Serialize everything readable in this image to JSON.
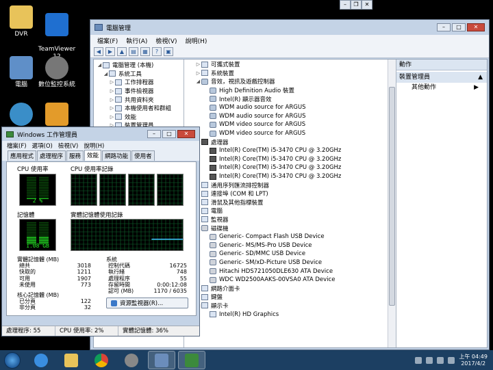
{
  "desktop": {
    "icons": [
      {
        "label": "DVR"
      },
      {
        "label": "TeamViewer\n12"
      },
      {
        "label": "電腦"
      },
      {
        "label": "數位監控系統"
      }
    ]
  },
  "device_manager": {
    "title": "電腦管理",
    "menu": [
      "檔案(F)",
      "執行(A)",
      "檢視(V)",
      "說明(H)"
    ],
    "left_tree": [
      {
        "label": "電腦管理 (本機)",
        "indent": 0
      },
      {
        "label": "系統工具",
        "indent": 1
      },
      {
        "label": "工作排程器",
        "indent": 2
      },
      {
        "label": "事件檢視器",
        "indent": 2
      },
      {
        "label": "共用資料夾",
        "indent": 2
      },
      {
        "label": "本機使用者和群組",
        "indent": 2
      },
      {
        "label": "效能",
        "indent": 2
      },
      {
        "label": "裝置管理員",
        "indent": 2
      }
    ],
    "device_tree": [
      {
        "label": "可攜式裝置",
        "level": 0,
        "icon": "device"
      },
      {
        "label": "系統裝置",
        "level": 0,
        "icon": "device"
      },
      {
        "label": "音效，視訊及遊戲控制器",
        "level": 0,
        "icon": "snd",
        "expanded": true
      },
      {
        "label": "High Definition Audio 裝置",
        "level": 1,
        "icon": "snd"
      },
      {
        "label": "Intel(R) 顯示器音效",
        "level": 1,
        "icon": "snd"
      },
      {
        "label": "WDM audio source for ARGUS",
        "level": 1,
        "icon": "snd"
      },
      {
        "label": "WDM audio source for ARGUS",
        "level": 1,
        "icon": "snd"
      },
      {
        "label": "WDM video source for ARGUS",
        "level": 1,
        "icon": "snd"
      },
      {
        "label": "WDM video source for ARGUS",
        "level": 1,
        "icon": "snd"
      },
      {
        "label": "處理器",
        "level": 0,
        "icon": "chip",
        "expanded": true
      },
      {
        "label": "Intel(R) Core(TM) i5-3470 CPU @ 3.20GHz",
        "level": 1,
        "icon": "chip"
      },
      {
        "label": "Intel(R) Core(TM) i5-3470 CPU @ 3.20GHz",
        "level": 1,
        "icon": "chip"
      },
      {
        "label": "Intel(R) Core(TM) i5-3470 CPU @ 3.20GHz",
        "level": 1,
        "icon": "chip"
      },
      {
        "label": "Intel(R) Core(TM) i5-3470 CPU @ 3.20GHz",
        "level": 1,
        "icon": "chip"
      },
      {
        "label": "通用序列匯流排控制器",
        "level": 0,
        "icon": "device"
      },
      {
        "label": "連接埠 (COM 和 LPT)",
        "level": 0,
        "icon": "device"
      },
      {
        "label": "滑鼠及其他指標裝置",
        "level": 0,
        "icon": "device"
      },
      {
        "label": "電腦",
        "level": 0,
        "icon": "device"
      },
      {
        "label": "監視器",
        "level": 0,
        "icon": "device"
      },
      {
        "label": "磁碟機",
        "level": 0,
        "icon": "disk",
        "expanded": true
      },
      {
        "label": "Generic- Compact Flash USB Device",
        "level": 1,
        "icon": "disk"
      },
      {
        "label": "Generic- MS/MS-Pro USB Device",
        "level": 1,
        "icon": "disk"
      },
      {
        "label": "Generic- SD/MMC USB Device",
        "level": 1,
        "icon": "disk"
      },
      {
        "label": "Generic- SM/xD-Picture USB Device",
        "level": 1,
        "icon": "disk"
      },
      {
        "label": "Hitachi HDS721050DLE630 ATA Device",
        "level": 1,
        "icon": "disk"
      },
      {
        "label": "WDC WD2500AAKS-00VSA0 ATA Device",
        "level": 1,
        "icon": "disk"
      },
      {
        "label": "網路介面卡",
        "level": 0,
        "icon": "device"
      },
      {
        "label": "鍵盤",
        "level": 0,
        "icon": "device"
      },
      {
        "label": "顯示卡",
        "level": 0,
        "icon": "device",
        "expanded": true
      },
      {
        "label": "Intel(R) HD Graphics",
        "level": 1,
        "icon": "device"
      }
    ],
    "actions": {
      "header": "動作",
      "section": "裝置管理員",
      "sub": "其他動作"
    }
  },
  "task_manager": {
    "title": "Windows 工作管理員",
    "menu": [
      "檔案(F)",
      "選項(O)",
      "檢視(V)",
      "說明(H)"
    ],
    "tabs": [
      "應用程式",
      "處理程序",
      "服務",
      "效能",
      "網路功能",
      "使用者"
    ],
    "active_tab": 3,
    "cpu_usage_label": "CPU 使用率",
    "cpu_history_label": "CPU 使用率記錄",
    "memory_label": "記憶體",
    "memory_history_label": "實體記憶體使用記錄",
    "cpu_usage_value": "2 %",
    "cpu_fraction": 0.02,
    "memory_value": "1.08 GB",
    "memory_fraction": 0.36,
    "physical_memory": {
      "title": "實體記憶體 (MB)",
      "rows": [
        [
          "總共",
          "3018"
        ],
        [
          "快取的",
          "1211"
        ],
        [
          "可用",
          "1907"
        ],
        [
          "未使用",
          "773"
        ]
      ]
    },
    "kernel_memory": {
      "title": "核心記憶體 (MB)",
      "rows": [
        [
          "已分頁",
          "122"
        ],
        [
          "非分頁",
          "32"
        ]
      ]
    },
    "system": {
      "title": "系統",
      "rows": [
        [
          "控制代碼",
          "16725"
        ],
        [
          "執行緒",
          "748"
        ],
        [
          "處理程序",
          "55"
        ],
        [
          "存留時間",
          "0:00:12:08"
        ],
        [
          "認可 (MB)",
          "1170 / 6035"
        ]
      ]
    },
    "resource_button": "資源監視器(R)...",
    "status": {
      "processes": "處理程序: 55",
      "cpu": "CPU 使用率: 2%",
      "memory": "實體記憶體: 36%"
    }
  },
  "taskbar": {
    "clock_time": "上午 04:49",
    "clock_date": "2017/4/2"
  }
}
